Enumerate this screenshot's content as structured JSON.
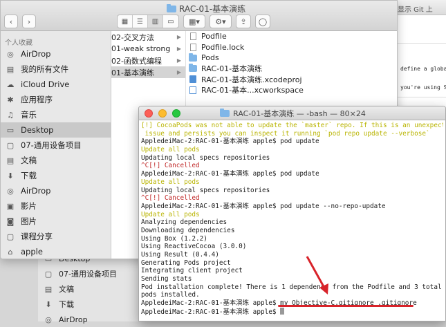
{
  "finder": {
    "title": "RAC-01-基本演练",
    "sidebar_section": "个人收藏",
    "sidebar_items": [
      {
        "label": "AirDrop",
        "icon": "airdrop-icon"
      },
      {
        "label": "我的所有文件",
        "icon": "all-files-icon"
      },
      {
        "label": "iCloud Drive",
        "icon": "cloud-icon"
      },
      {
        "label": "应用程序",
        "icon": "applications-icon"
      },
      {
        "label": "音乐",
        "icon": "music-icon"
      },
      {
        "label": "Desktop",
        "icon": "desktop-icon",
        "selected": true
      },
      {
        "label": "07-通用设备项目",
        "icon": "folder-icon"
      },
      {
        "label": "文稿",
        "icon": "documents-icon"
      },
      {
        "label": "下载",
        "icon": "download-icon"
      },
      {
        "label": "AirDrop",
        "icon": "airdrop-icon"
      },
      {
        "label": "影片",
        "icon": "movies-icon"
      },
      {
        "label": "图片",
        "icon": "pictures-icon"
      },
      {
        "label": "课程分享",
        "icon": "folder-icon"
      },
      {
        "label": "apple",
        "icon": "home-icon"
      }
    ],
    "column1": [
      {
        "label": "02-交叉方法"
      },
      {
        "label": "01-weak strong"
      },
      {
        "label": "02-函数式编程"
      },
      {
        "label": "01-基本演练",
        "selected": true
      }
    ],
    "column2": [
      {
        "label": "Podfile",
        "icon": "document-icon"
      },
      {
        "label": "Podfile.lock",
        "icon": "document-icon"
      },
      {
        "label": "Pods",
        "icon": "folder-icon"
      },
      {
        "label": "RAC-01-基本演练",
        "icon": "folder-icon"
      },
      {
        "label": "RAC-01-基本演练.xcodeproj",
        "icon": "xcodeproj-icon"
      },
      {
        "label": "RAC-01-基本...xcworkspace",
        "icon": "xcworkspace-icon"
      }
    ]
  },
  "finder2": {
    "items": [
      {
        "label": "Desktop",
        "icon": "desktop-icon"
      },
      {
        "label": "07-通用设备项目",
        "icon": "folder-icon"
      },
      {
        "label": "文稿",
        "icon": "documents-icon"
      },
      {
        "label": "下载",
        "icon": "download-icon"
      },
      {
        "label": "AirDrop",
        "icon": "airdrop-icon"
      }
    ]
  },
  "background_doc": {
    "top_text": "中显示 Git 上",
    "line1": "define a global",
    "line2": "you're using Sw"
  },
  "terminal": {
    "title": "RAC-01-基本演练 — -bash — 80×24",
    "lines": [
      {
        "text": "[!] CocoaPods was not able to update the `master` repo. If this is an unexpected",
        "style": "yellow"
      },
      {
        "text": " issue and persists you can inspect it running `pod repo update --verbose`",
        "style": "yellow"
      },
      {
        "text": "AppledeiMac-2:RAC-01-基本演练 apple$ pod update",
        "style": "cmd"
      },
      {
        "text": "Update all pods",
        "style": "yellow"
      },
      {
        "text": "Updating local specs repositories",
        "style": "cmd"
      },
      {
        "text": "^C[!] Cancelled",
        "style": "red"
      },
      {
        "text": "AppledeiMac-2:RAC-01-基本演练 apple$ pod update",
        "style": "cmd"
      },
      {
        "text": "Update all pods",
        "style": "yellow"
      },
      {
        "text": "Updating local specs repositories",
        "style": "cmd"
      },
      {
        "text": "^C[!] Cancelled",
        "style": "red"
      },
      {
        "text": "AppledeiMac-2:RAC-01-基本演练 apple$ pod update --no-repo-update",
        "style": "cmd"
      },
      {
        "text": "Update all pods",
        "style": "yellow"
      },
      {
        "text": "Analyzing dependencies",
        "style": "cmd"
      },
      {
        "text": "Downloading dependencies",
        "style": "cmd"
      },
      {
        "text": "Using Box (1.2.2)",
        "style": "cmd"
      },
      {
        "text": "Using ReactiveCocoa (3.0.0)",
        "style": "cmd"
      },
      {
        "text": "Using Result (0.4.4)",
        "style": "cmd"
      },
      {
        "text": "Generating Pods project",
        "style": "cmd"
      },
      {
        "text": "Integrating client project",
        "style": "cmd"
      },
      {
        "text": "Sending stats",
        "style": "cmd"
      },
      {
        "text": "Pod installation complete! There is 1 dependency from the Podfile and 3 total",
        "style": "cmd"
      },
      {
        "text": "pods installed.",
        "style": "cmd"
      },
      {
        "text": "AppledeiMac-2:RAC-01-基本演练 apple$ mv Objective-C.gitignore .gitignore",
        "style": "cmd"
      },
      {
        "text": "AppledeiMac-2:RAC-01-基本演练 apple$ ",
        "style": "cmd",
        "cursor": true
      }
    ]
  },
  "colors": {
    "annotation_red": "#d8232a",
    "terminal_yellow": "#b9b400",
    "terminal_red": "#c02828"
  }
}
